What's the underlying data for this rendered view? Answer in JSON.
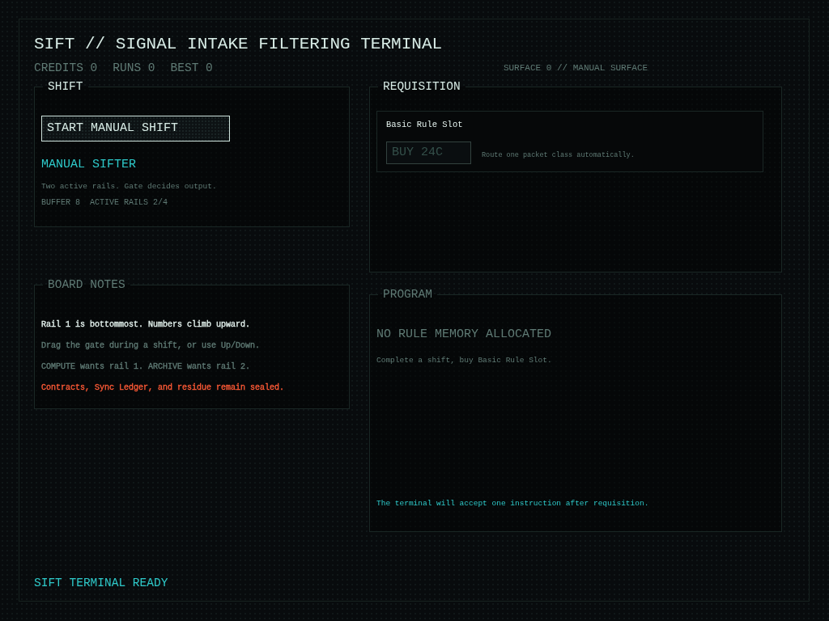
{
  "title": "SIFT // SIGNAL INTAKE FILTERING TERMINAL",
  "stats": [
    "CREDITS 0",
    "RUNS 0",
    "BEST 0"
  ],
  "surface": "SURFACE 0 // MANUAL SURFACE",
  "shift": {
    "legend": "SHIFT",
    "active": true,
    "button": "START MANUAL SHIFT",
    "mode": "MANUAL SIFTER",
    "description": "Two active rails. Gate decides output.",
    "readouts": [
      "BUFFER 8",
      "ACTIVE RAILS 2/4"
    ]
  },
  "requisition": {
    "legend": "REQUISITION",
    "active": true,
    "items": [
      {
        "name": "Basic Rule Slot",
        "button": "BUY 24C",
        "disabled": true,
        "description": "Route one packet class automatically."
      }
    ]
  },
  "board_notes": {
    "legend": "BOARD NOTES",
    "active": false,
    "notes": [
      {
        "text": "Rail 1 is bottommost. Numbers climb upward.",
        "color": "#e4f2ee"
      },
      {
        "text": "Drag the gate during a shift, or use Up/Down.",
        "color": "#5f7a74"
      },
      {
        "text": "COMPUTE wants rail 1. ARCHIVE wants rail 2.",
        "color": "#5f7a74"
      },
      {
        "text": "Contracts, Sync Ledger, and residue remain sealed.",
        "color": "#ff5a36"
      }
    ]
  },
  "program": {
    "legend": "PROGRAM",
    "active": false,
    "heading": "NO RULE MEMORY ALLOCATED",
    "hint": "Complete a shift, buy Basic Rule Slot.",
    "note": "The terminal will accept one instruction after requisition."
  },
  "status_bar": {
    "text": "SIFT TERMINAL READY"
  }
}
